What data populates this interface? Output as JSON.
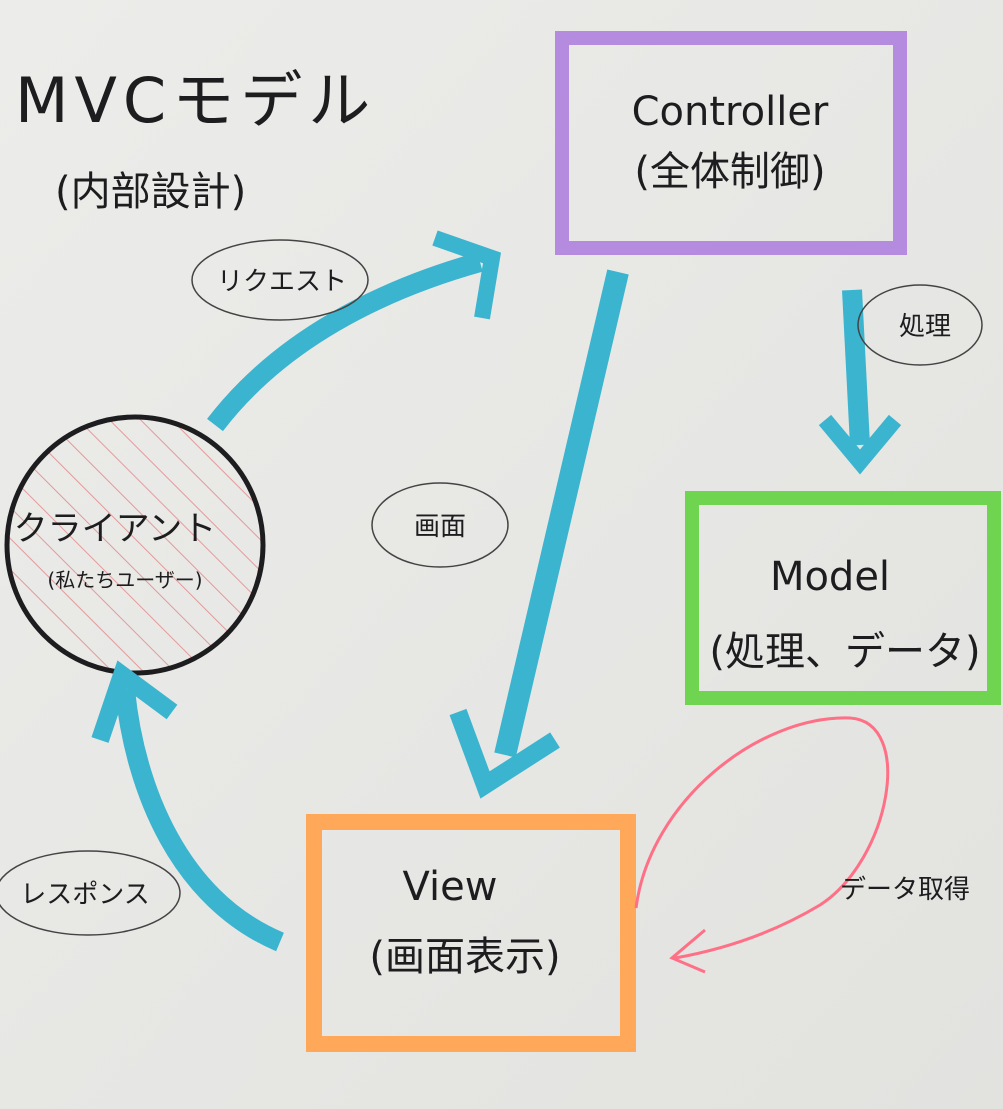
{
  "title": "MVCモデル",
  "subtitle": "(内部設計)",
  "nodes": {
    "controller": {
      "name": "Controller",
      "desc": "(全体制御)",
      "color": "#b58be0"
    },
    "model": {
      "name": "Model",
      "desc": "(処理、データ)",
      "color": "#6fd44f"
    },
    "view": {
      "name": "View",
      "desc": "(画面表示)",
      "color": "#ffa85a"
    },
    "client": {
      "name": "クライアント",
      "desc": "(私たちユーザー)",
      "hatch_color": "#e39a9a"
    }
  },
  "edges": {
    "request": {
      "label": "リクエスト",
      "from": "client",
      "to": "controller",
      "color": "#3bb4cf"
    },
    "process": {
      "label": "処理",
      "from": "controller",
      "to": "model",
      "color": "#3bb4cf"
    },
    "screen": {
      "label": "画面",
      "from": "controller",
      "to": "view",
      "color": "#3bb4cf"
    },
    "response": {
      "label": "レスポンス",
      "from": "view",
      "to": "client",
      "color": "#3bb4cf"
    },
    "data_fetch": {
      "label": "データ取得",
      "from": "model",
      "to": "view",
      "color": "#ff6f86"
    }
  }
}
